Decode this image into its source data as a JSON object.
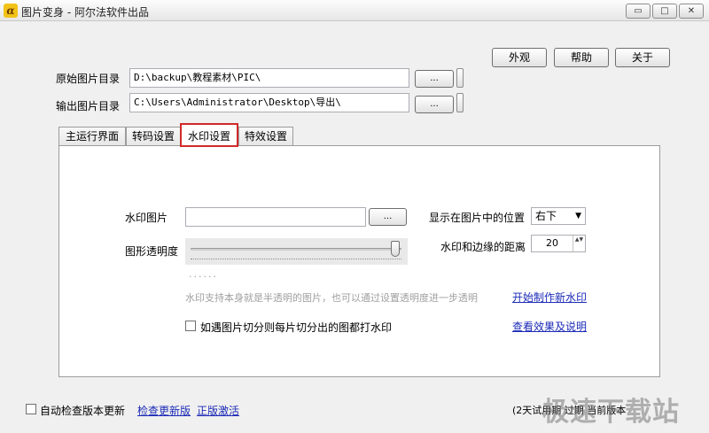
{
  "window": {
    "app_icon": "α",
    "title": "图片变身 - 阿尔法软件出品",
    "min_icon": "▭",
    "max_icon": "□",
    "close_icon": "✕"
  },
  "toolbar": {
    "appearance": "外观",
    "help": "帮助",
    "about": "关于"
  },
  "paths": {
    "source_label": "原始图片目录",
    "source_value": "D:\\backup\\教程素材\\PIC\\",
    "output_label": "输出图片目录",
    "output_value": "C:\\Users\\Administrator\\Desktop\\导出\\",
    "browse_label": "..."
  },
  "tabs": [
    {
      "label": "主运行界面"
    },
    {
      "label": "转码设置"
    },
    {
      "label": "水印设置"
    },
    {
      "label": "特效设置"
    }
  ],
  "watermark_panel": {
    "image_label": "水印图片",
    "image_value": "",
    "browse_label": "...",
    "opacity_label": "图形透明度",
    "opacity_dots": "......",
    "position_label": "显示在图片中的位置",
    "position_value": "右下",
    "position_arrow": "▼",
    "margin_label": "水印和边缘的距离",
    "margin_value": "20",
    "spin_arrows": "▲▼",
    "hint": "水印支持本身就是半透明的图片，也可以通过设置透明度进一步透明",
    "create_link": "开始制作新水印",
    "split_checkbox_label": "如遇图片切分则每片切分出的图都打水印",
    "effect_link": "查看效果及说明"
  },
  "footer": {
    "auto_check_label": "自动检查版本更新",
    "check_update_link": "检查更新版",
    "activate_link": "正版激活",
    "trial_text": "(2天试用期    过期    当前版本"
  },
  "overlay": {
    "watermark_text": "极速下载站"
  }
}
